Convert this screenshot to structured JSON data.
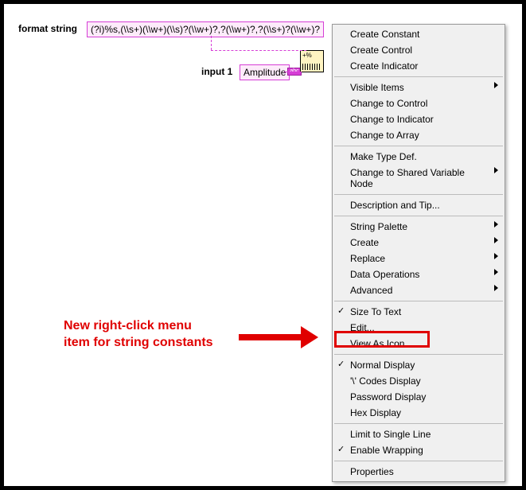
{
  "labels": {
    "format_string": "format string",
    "input_1": "input 1"
  },
  "values": {
    "format_string": "(?i)%s,(\\\\s+)(\\\\w+)(\\\\s)?(\\\\w+)?,?(\\\\w+)?,?(\\\\s+)?(\\\\w+)?",
    "input_1": "Amplitude"
  },
  "annotation": {
    "line1": "New right-click menu",
    "line2": "item for string constants"
  },
  "menu": {
    "items": [
      {
        "label": "Create Constant",
        "sub": false,
        "check": false
      },
      {
        "label": "Create Control",
        "sub": false,
        "check": false
      },
      {
        "label": "Create Indicator",
        "sub": false,
        "check": false
      },
      {
        "sep": true
      },
      {
        "label": "Visible Items",
        "sub": true,
        "check": false
      },
      {
        "label": "Change to Control",
        "sub": false,
        "check": false
      },
      {
        "label": "Change to Indicator",
        "sub": false,
        "check": false
      },
      {
        "label": "Change to Array",
        "sub": false,
        "check": false
      },
      {
        "sep": true
      },
      {
        "label": "Make Type Def.",
        "sub": false,
        "check": false
      },
      {
        "label": "Change to Shared Variable Node",
        "sub": true,
        "check": false
      },
      {
        "sep": true
      },
      {
        "label": "Description and Tip...",
        "sub": false,
        "check": false
      },
      {
        "sep": true
      },
      {
        "label": "String Palette",
        "sub": true,
        "check": false
      },
      {
        "label": "Create",
        "sub": true,
        "check": false
      },
      {
        "label": "Replace",
        "sub": true,
        "check": false
      },
      {
        "label": "Data Operations",
        "sub": true,
        "check": false
      },
      {
        "label": "Advanced",
        "sub": true,
        "check": false
      },
      {
        "sep": true
      },
      {
        "label": "Size To Text",
        "sub": false,
        "check": true
      },
      {
        "label": "Edit...",
        "sub": false,
        "check": false
      },
      {
        "label": "View As Icon",
        "sub": false,
        "check": false
      },
      {
        "sep": true
      },
      {
        "label": "Normal Display",
        "sub": false,
        "check": true
      },
      {
        "label": "'\\' Codes Display",
        "sub": false,
        "check": false
      },
      {
        "label": "Password Display",
        "sub": false,
        "check": false
      },
      {
        "label": "Hex Display",
        "sub": false,
        "check": false
      },
      {
        "sep": true
      },
      {
        "label": "Limit to Single Line",
        "sub": false,
        "check": false
      },
      {
        "label": "Enable Wrapping",
        "sub": false,
        "check": true
      },
      {
        "sep": true
      },
      {
        "label": "Properties",
        "sub": false,
        "check": false
      }
    ]
  }
}
